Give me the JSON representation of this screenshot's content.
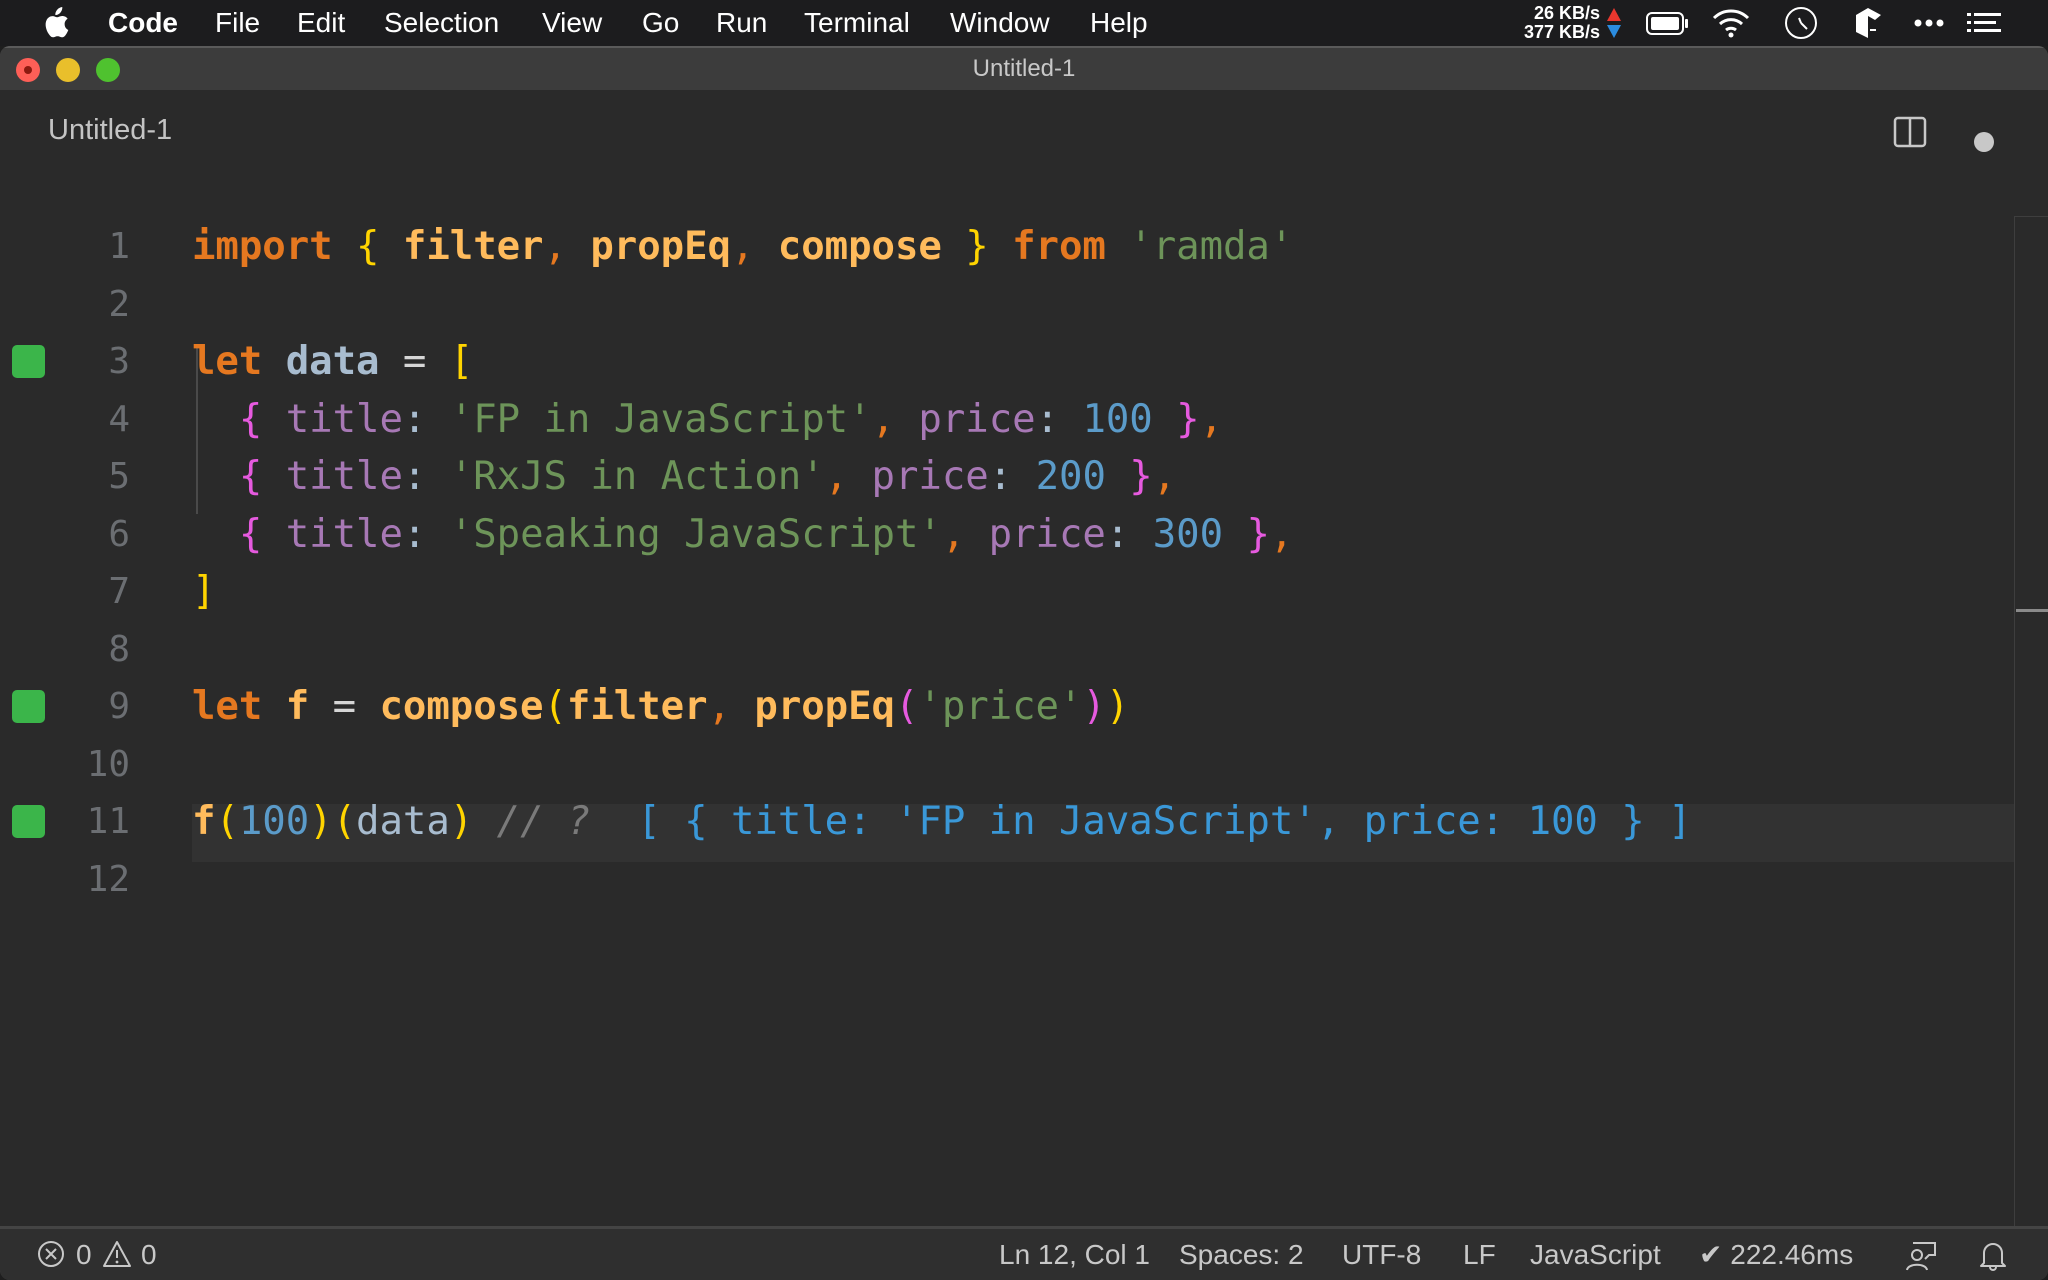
{
  "menubar": {
    "app_name": "Code",
    "items": [
      "File",
      "Edit",
      "Selection",
      "View",
      "Go",
      "Run",
      "Terminal",
      "Window",
      "Help"
    ],
    "network": {
      "upload": "26 KB/s",
      "download": "377 KB/s"
    },
    "tray_icons": [
      "network-speed-icon",
      "battery-icon",
      "wifi-icon",
      "clock-icon",
      "app-tray-icon",
      "more-icon",
      "list-icon"
    ]
  },
  "window": {
    "title": "Untitled-1"
  },
  "tab": {
    "label": "Untitled-1",
    "dirty": true
  },
  "editor": {
    "current_line": 12,
    "lines": [
      {
        "num": "1",
        "mark": false,
        "tokens": [
          {
            "t": "import",
            "c": "kw"
          },
          {
            "t": " ",
            "c": "op"
          },
          {
            "t": "{",
            "c": "br1"
          },
          {
            "t": " filter",
            "c": "fn"
          },
          {
            "t": ",",
            "c": "punc"
          },
          {
            "t": " propEq",
            "c": "fn"
          },
          {
            "t": ",",
            "c": "punc"
          },
          {
            "t": " compose ",
            "c": "fn"
          },
          {
            "t": "}",
            "c": "br1"
          },
          {
            "t": " from",
            "c": "kw"
          },
          {
            "t": " 'ramda'",
            "c": "str"
          }
        ]
      },
      {
        "num": "2",
        "mark": false,
        "tokens": []
      },
      {
        "num": "3",
        "mark": true,
        "tokens": [
          {
            "t": "let",
            "c": "kw"
          },
          {
            "t": " data",
            "c": "var"
          },
          {
            "t": " = ",
            "c": "op"
          },
          {
            "t": "[",
            "c": "br1"
          }
        ]
      },
      {
        "num": "4",
        "mark": false,
        "tokens": [
          {
            "t": "  ",
            "c": "op"
          },
          {
            "t": "{",
            "c": "br2"
          },
          {
            "t": " title",
            "c": "prop"
          },
          {
            "t": ": ",
            "c": "colon"
          },
          {
            "t": "'FP in JavaScript'",
            "c": "str"
          },
          {
            "t": ",",
            "c": "punc"
          },
          {
            "t": " price",
            "c": "prop"
          },
          {
            "t": ": ",
            "c": "colon"
          },
          {
            "t": "100",
            "c": "num"
          },
          {
            "t": " }",
            "c": "br2"
          },
          {
            "t": ",",
            "c": "punc"
          }
        ]
      },
      {
        "num": "5",
        "mark": false,
        "tokens": [
          {
            "t": "  ",
            "c": "op"
          },
          {
            "t": "{",
            "c": "br2"
          },
          {
            "t": " title",
            "c": "prop"
          },
          {
            "t": ": ",
            "c": "colon"
          },
          {
            "t": "'RxJS in Action'",
            "c": "str"
          },
          {
            "t": ",",
            "c": "punc"
          },
          {
            "t": " price",
            "c": "prop"
          },
          {
            "t": ": ",
            "c": "colon"
          },
          {
            "t": "200",
            "c": "num"
          },
          {
            "t": " }",
            "c": "br2"
          },
          {
            "t": ",",
            "c": "punc"
          }
        ]
      },
      {
        "num": "6",
        "mark": false,
        "tokens": [
          {
            "t": "  ",
            "c": "op"
          },
          {
            "t": "{",
            "c": "br2"
          },
          {
            "t": " title",
            "c": "prop"
          },
          {
            "t": ": ",
            "c": "colon"
          },
          {
            "t": "'Speaking JavaScript'",
            "c": "str"
          },
          {
            "t": ",",
            "c": "punc"
          },
          {
            "t": " price",
            "c": "prop"
          },
          {
            "t": ": ",
            "c": "colon"
          },
          {
            "t": "300",
            "c": "num"
          },
          {
            "t": " }",
            "c": "br2"
          },
          {
            "t": ",",
            "c": "punc"
          }
        ]
      },
      {
        "num": "7",
        "mark": false,
        "tokens": [
          {
            "t": "]",
            "c": "br1"
          }
        ]
      },
      {
        "num": "8",
        "mark": false,
        "tokens": []
      },
      {
        "num": "9",
        "mark": true,
        "tokens": [
          {
            "t": "let",
            "c": "kw"
          },
          {
            "t": " f",
            "c": "fn"
          },
          {
            "t": " = ",
            "c": "op"
          },
          {
            "t": "compose",
            "c": "fn"
          },
          {
            "t": "(",
            "c": "br1"
          },
          {
            "t": "filter",
            "c": "fn"
          },
          {
            "t": ",",
            "c": "punc"
          },
          {
            "t": " propEq",
            "c": "fn"
          },
          {
            "t": "(",
            "c": "br2"
          },
          {
            "t": "'price'",
            "c": "str"
          },
          {
            "t": ")",
            "c": "br2"
          },
          {
            "t": ")",
            "c": "br1"
          }
        ]
      },
      {
        "num": "10",
        "mark": false,
        "tokens": []
      },
      {
        "num": "11",
        "mark": true,
        "tokens": [
          {
            "t": "f",
            "c": "fn"
          },
          {
            "t": "(",
            "c": "br1"
          },
          {
            "t": "100",
            "c": "num"
          },
          {
            "t": ")",
            "c": "br1"
          },
          {
            "t": "(",
            "c": "br1"
          },
          {
            "t": "data",
            "c": "plain"
          },
          {
            "t": ")",
            "c": "br1"
          },
          {
            "t": " // ?  ",
            "c": "cmt"
          },
          {
            "t": "[ { title: 'FP in JavaScript', price: 100 } ]",
            "c": "res"
          }
        ]
      },
      {
        "num": "12",
        "mark": false,
        "tokens": []
      }
    ]
  },
  "statusbar": {
    "errors": "0",
    "warnings": "0",
    "cursor": "Ln 12, Col 1",
    "indent": "Spaces: 2",
    "encoding": "UTF-8",
    "eol": "LF",
    "language": "JavaScript",
    "timing": "✔ 222.46ms"
  },
  "colors": {
    "coverage_mark": "#3bb54a",
    "keyword": "#e57820",
    "string": "#6d9459",
    "number": "#5b9bc9",
    "property": "#a778b5",
    "inline_result": "#3a98d8"
  }
}
